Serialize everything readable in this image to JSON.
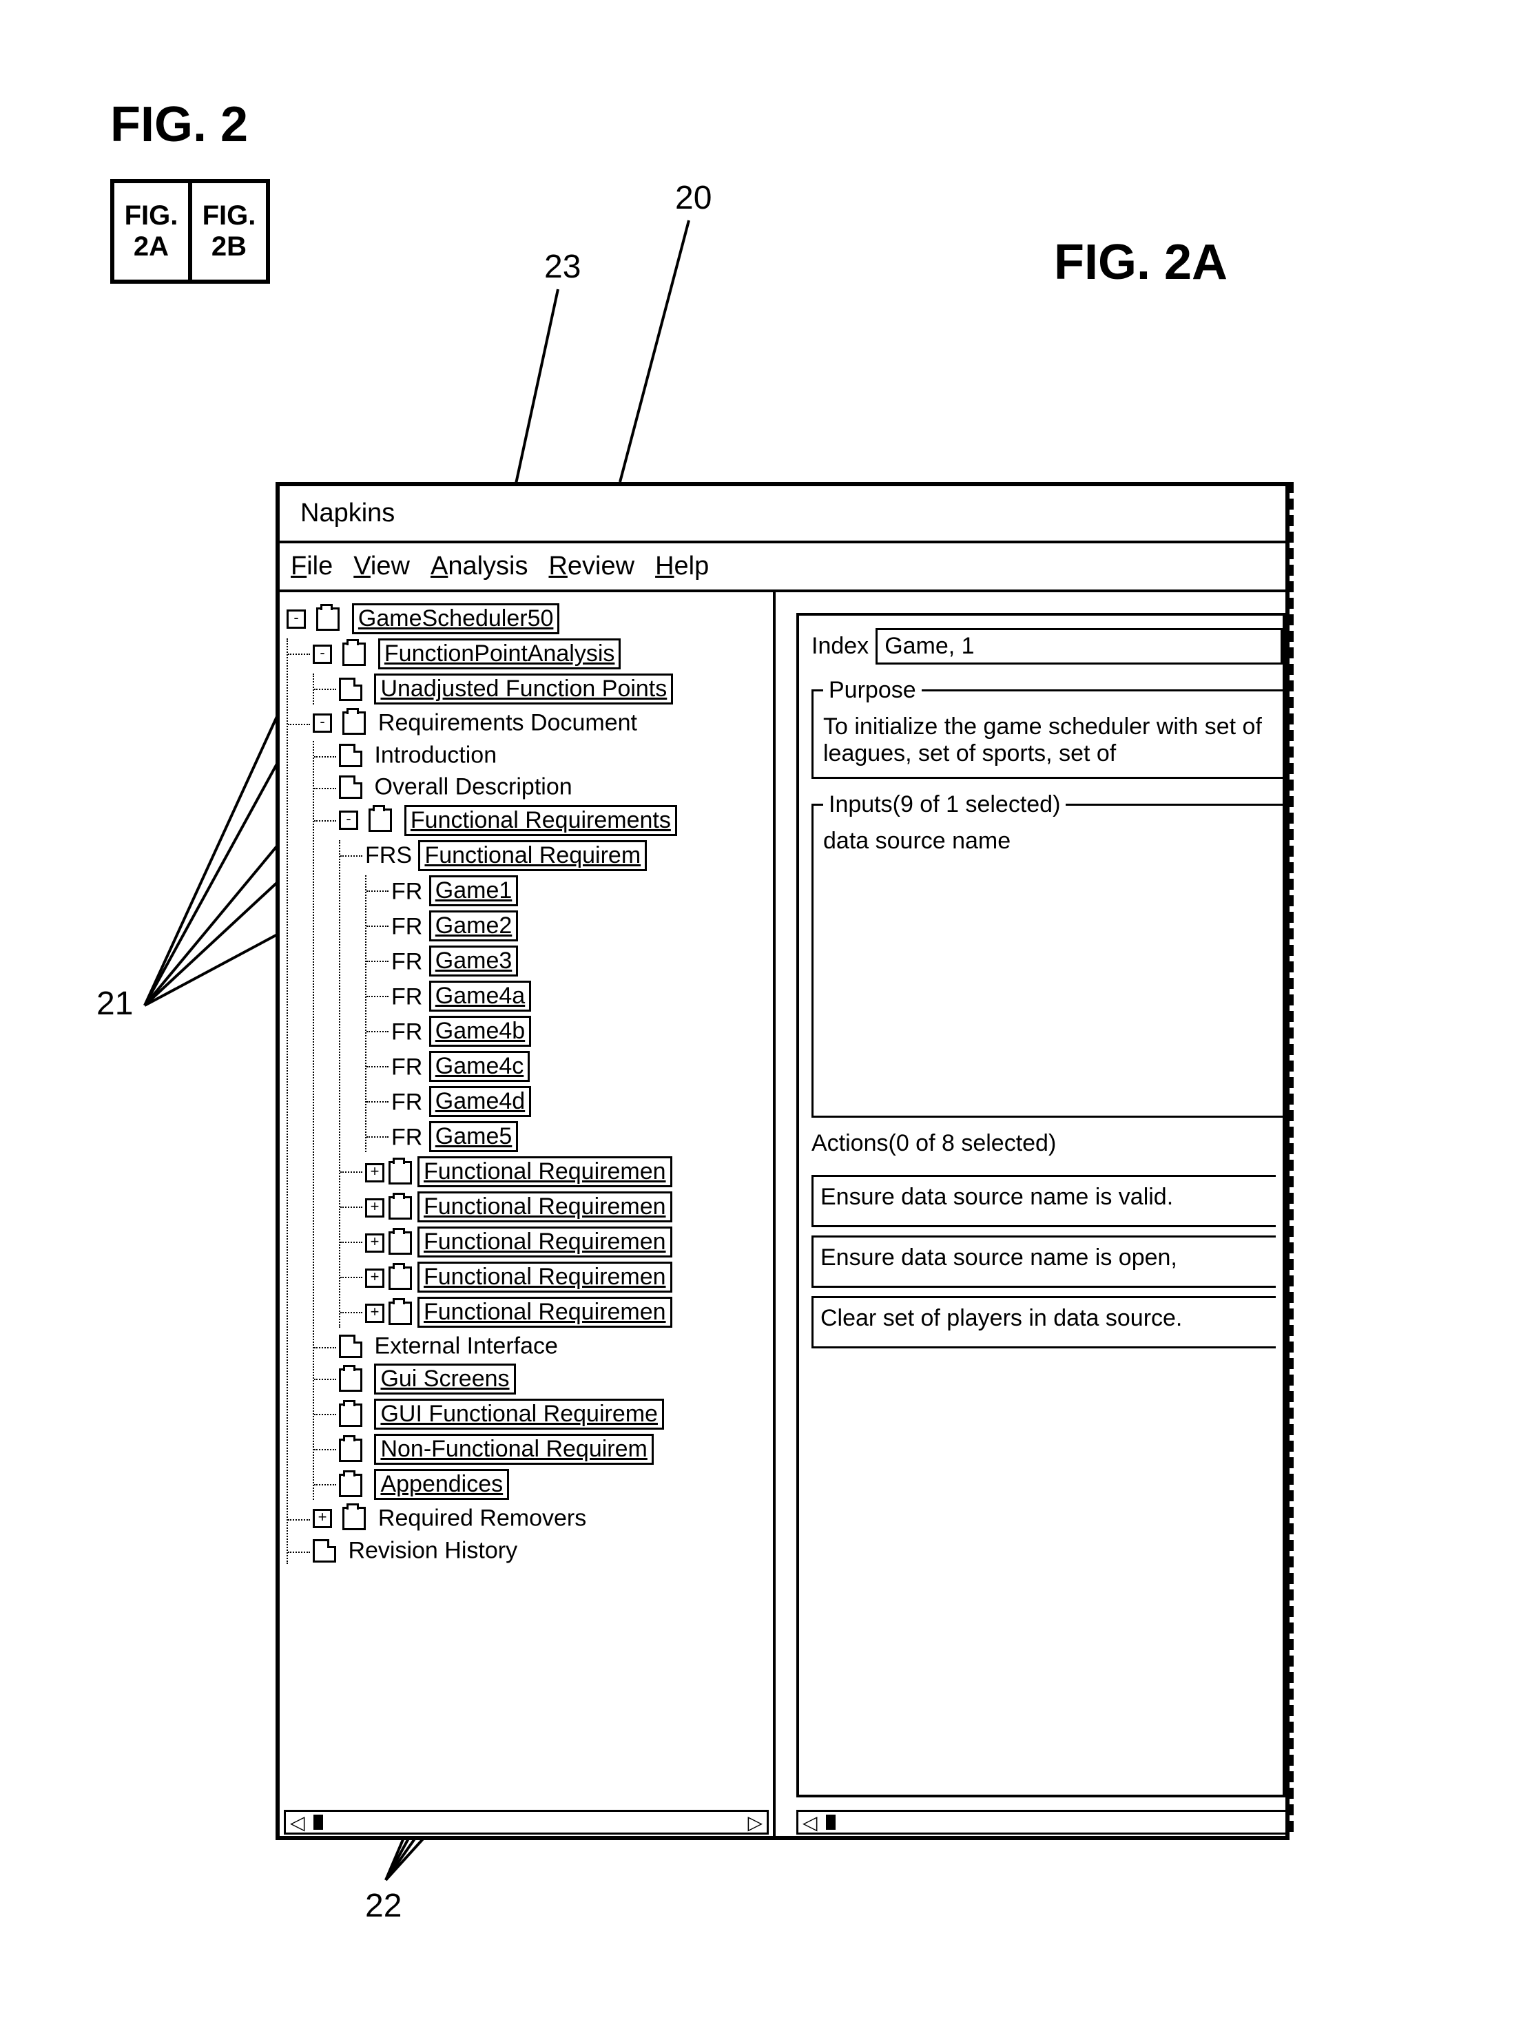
{
  "figure": {
    "main_label": "FIG. 2",
    "sub_a": "FIG.\n2A",
    "sub_b": "FIG.\n2B",
    "right_label": "FIG. 2A"
  },
  "callouts": {
    "c20": "20",
    "c21": "21",
    "c22": "22",
    "c23": "23"
  },
  "window": {
    "title": "Napkins",
    "menus": {
      "file": "File",
      "view": "View",
      "analysis": "Analysis",
      "review": "Review",
      "help": "Help"
    }
  },
  "tree": {
    "root": "GameScheduler50",
    "fpa": "FunctionPointAnalysis",
    "ufp": "Unadjusted Function Points",
    "req_doc": "Requirements Document",
    "intro": "Introduction",
    "overall": "Overall Description",
    "func_req": "Functional Requirements",
    "frs_prefix": "FRS",
    "frs_box": "Functional Requirem",
    "fr_prefix": "FR",
    "fr_items": [
      "Game1",
      "Game2",
      "Game3",
      "Game4a",
      "Game4b",
      "Game4c",
      "Game4d",
      "Game5"
    ],
    "fr_more": [
      "Functional Requiremen",
      "Functional Requiremen",
      "Functional Requiremen",
      "Functional Requiremen",
      "Functional Requiremen"
    ],
    "ext_if": "External Interface",
    "gui_screens": "Gui Screens",
    "gui_func": "GUI Functional Requireme",
    "non_func": "Non-Functional Requirem",
    "appendices": "Appendices",
    "req_removers": "Required Removers",
    "rev_hist": "Revision History"
  },
  "detail": {
    "index_label": "Index",
    "index_value": "Game, 1",
    "purpose_legend": "Purpose",
    "purpose_text": "To initialize the game scheduler with set of leagues, set of sports, set of",
    "inputs_legend": "Inputs(9 of 1 selected)",
    "inputs_text": "data source name",
    "actions_legend": "Actions(0 of 8 selected)",
    "actions": [
      "Ensure data source name is valid.",
      "Ensure data source name is open,",
      "Clear set of players in data source."
    ]
  },
  "glyphs": {
    "tri_left": "◁",
    "tri_right": "▷"
  }
}
